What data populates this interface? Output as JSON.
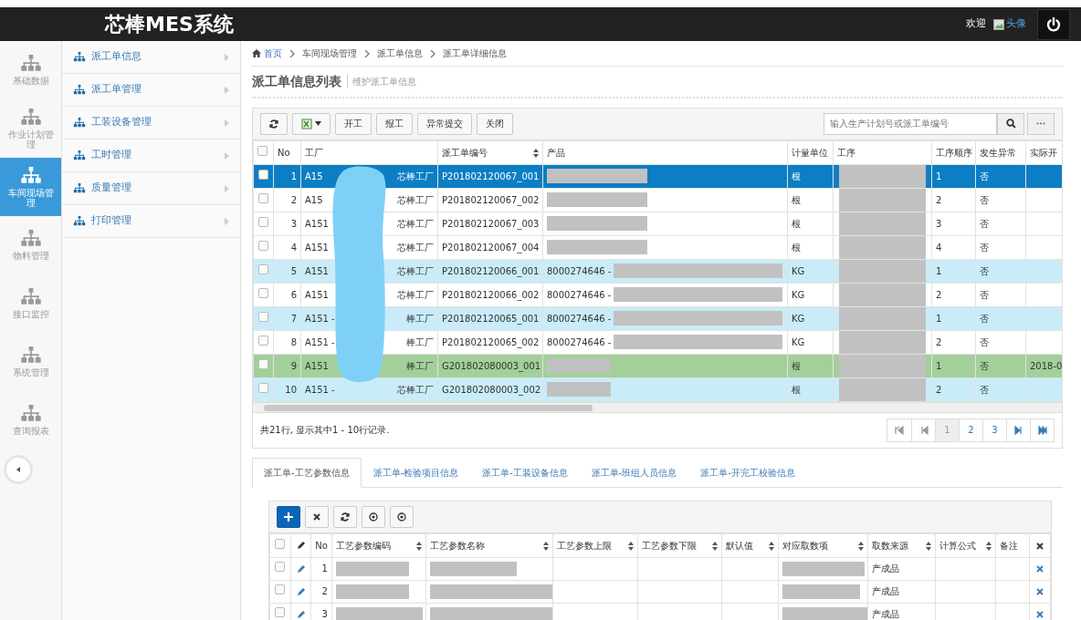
{
  "header": {
    "title": "芯棒MES系统",
    "welcome": "欢迎",
    "avatar_alt": "头像"
  },
  "icon_nav": [
    {
      "label": "基础数据",
      "selected": false
    },
    {
      "label": "作业计划管理",
      "selected": false
    },
    {
      "label": "车间现场管理",
      "selected": true
    },
    {
      "label": "物料管理",
      "selected": false
    },
    {
      "label": "接口监控",
      "selected": false
    },
    {
      "label": "系统管理",
      "selected": false
    },
    {
      "label": "查询报表",
      "selected": false
    }
  ],
  "submenu": [
    {
      "label": "派工单信息"
    },
    {
      "label": "派工单管理"
    },
    {
      "label": "工装设备管理"
    },
    {
      "label": "工时管理"
    },
    {
      "label": "质量管理"
    },
    {
      "label": "打印管理"
    }
  ],
  "breadcrumb": [
    "首页",
    "车间现场管理",
    "派工单信息",
    "派工单详细信息"
  ],
  "page_title": "派工单信息列表",
  "page_subtitle": "维护派工单信息",
  "toolbar": [
    {
      "kind": "refresh"
    },
    {
      "kind": "export"
    },
    {
      "kind": "text",
      "label": "开工"
    },
    {
      "kind": "text",
      "label": "报工"
    },
    {
      "kind": "text",
      "label": "异常提交"
    },
    {
      "kind": "text",
      "label": "关闭"
    }
  ],
  "search": {
    "placeholder": "输入生产计划号或派工单编号"
  },
  "table": {
    "all_checked": false,
    "columns": [
      {
        "label": "No",
        "sortable": false
      },
      {
        "label": "工厂",
        "sortable": false
      },
      {
        "label": "派工单编号",
        "sortable": true
      },
      {
        "label": "产品",
        "sortable": false
      },
      {
        "label": "计量单位",
        "sortable": false
      },
      {
        "label": "工序",
        "sortable": false
      },
      {
        "label": "工序顺序",
        "sortable": false
      },
      {
        "label": "发生异常",
        "sortable": false
      },
      {
        "label": "实际开",
        "sortable": false
      }
    ],
    "rows": [
      {
        "no": "1",
        "factory_code": "A15",
        "factory_name": "芯棒工厂",
        "order": "P201802120067_001",
        "product": "",
        "unit": "根",
        "seq": "1",
        "abnormal": "否",
        "start": "",
        "selected": true
      },
      {
        "no": "2",
        "factory_code": "A15",
        "factory_name": "芯棒工厂",
        "order": "P201802120067_002",
        "product": "",
        "unit": "根",
        "seq": "2",
        "abnormal": "否",
        "start": "",
        "selected": false,
        "color": "#ffffff"
      },
      {
        "no": "3",
        "factory_code": "A151",
        "factory_name": "芯棒工厂",
        "order": "P201802120067_003",
        "product": "",
        "unit": "根",
        "seq": "3",
        "abnormal": "否",
        "start": "",
        "selected": false,
        "color": "#ffffff"
      },
      {
        "no": "4",
        "factory_code": "A151",
        "factory_name": "芯棒工厂",
        "order": "P201802120067_004",
        "product": "",
        "unit": "根",
        "seq": "4",
        "abnormal": "否",
        "start": "",
        "selected": false,
        "color": "#ffffff"
      },
      {
        "no": "5",
        "factory_code": "A151",
        "factory_name": "芯棒工厂",
        "order": "P201802120066_001",
        "product": "8000274646 -",
        "unit": "KG",
        "seq": "1",
        "abnormal": "否",
        "start": "",
        "selected": false,
        "color": "#c9ecf8"
      },
      {
        "no": "6",
        "factory_code": "A151",
        "factory_name": "芯棒工厂",
        "order": "P201802120066_002",
        "product": "8000274646 -",
        "unit": "KG",
        "seq": "2",
        "abnormal": "否",
        "start": "",
        "selected": false,
        "color": "#ffffff"
      },
      {
        "no": "7",
        "factory_code": "A151 -",
        "factory_name": "棒工厂",
        "order": "P201802120065_001",
        "product": "8000274646 -",
        "unit": "KG",
        "seq": "1",
        "abnormal": "否",
        "start": "",
        "selected": false,
        "color": "#c9ecf8"
      },
      {
        "no": "8",
        "factory_code": "A151 -",
        "factory_name": "棒工厂",
        "order": "P201802120065_002",
        "product": "8000274646 -",
        "unit": "KG",
        "seq": "2",
        "abnormal": "否",
        "start": "",
        "selected": false,
        "color": "#ffffff"
      },
      {
        "no": "9",
        "factory_code": "A151",
        "factory_name": "棒工厂",
        "order": "G201802080003_001",
        "product": "",
        "unit": "根",
        "seq": "1",
        "abnormal": "否",
        "start": "2018-0",
        "selected": false,
        "color": "#a3cf9b"
      },
      {
        "no": "10",
        "factory_code": "A151 -",
        "factory_name": "芯棒工厂",
        "order": "G201802080003_002",
        "product": "",
        "unit": "根",
        "seq": "2",
        "abnormal": "否",
        "start": "",
        "selected": false,
        "color": "#c9ecf8"
      }
    ]
  },
  "summary": "共21行, 显示其中1 - 10行记录.",
  "pagination": [
    {
      "kind": "first",
      "selected": false
    },
    {
      "kind": "prev",
      "selected": false
    },
    {
      "kind": "page",
      "label": "1",
      "selected": true
    },
    {
      "kind": "page",
      "label": "2",
      "selected": false
    },
    {
      "kind": "page",
      "label": "3",
      "selected": false
    },
    {
      "kind": "next",
      "selected": false
    },
    {
      "kind": "last",
      "selected": false
    }
  ],
  "tabs": [
    {
      "label": "派工单-工艺参数信息",
      "selected": true
    },
    {
      "label": "派工单-检验项目信息",
      "selected": false
    },
    {
      "label": "派工单-工装设备信息",
      "selected": false
    },
    {
      "label": "派工单-班组人员信息",
      "selected": false
    },
    {
      "label": "派工单-开完工校验信息",
      "selected": false
    }
  ],
  "sub_toolbar": [
    {
      "kind": "add"
    },
    {
      "kind": "delete"
    },
    {
      "kind": "refresh"
    },
    {
      "kind": "target"
    },
    {
      "kind": "target"
    }
  ],
  "sub_table": {
    "all_checked": false,
    "columns": [
      {
        "label": "No",
        "sortable": false
      },
      {
        "label": "工艺参数编码",
        "sortable": true
      },
      {
        "label": "工艺参数名称",
        "sortable": true
      },
      {
        "label": "工艺参数上限",
        "sortable": true
      },
      {
        "label": "工艺参数下限",
        "sortable": true
      },
      {
        "label": "默认值",
        "sortable": true
      },
      {
        "label": "对应取数项",
        "sortable": true
      },
      {
        "label": "取数来源",
        "sortable": true
      },
      {
        "label": "计算公式",
        "sortable": true
      },
      {
        "label": "备注",
        "sortable": false
      }
    ],
    "rows": [
      {
        "no": "1",
        "source": "产成品",
        "checked": false
      },
      {
        "no": "2",
        "source": "产成品",
        "checked": false
      },
      {
        "no": "3",
        "source": "产成品",
        "checked": false
      }
    ]
  }
}
